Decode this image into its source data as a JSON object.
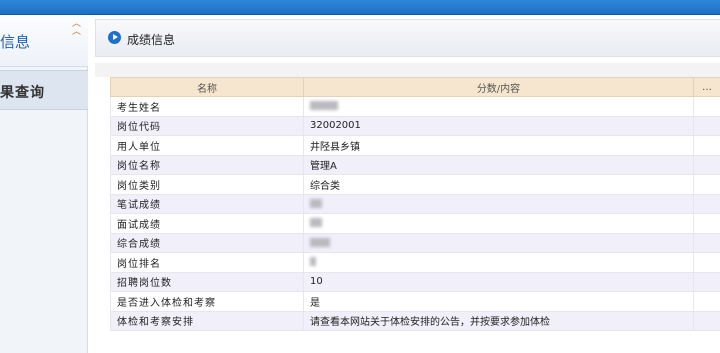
{
  "sidebar": {
    "title": "信息",
    "collapse_icon": "double-chevron-up",
    "item": "果查询"
  },
  "header": {
    "title": "成绩信息",
    "icon": "play-circle-icon"
  },
  "table": {
    "columns": [
      "名称",
      "分数/内容",
      "…"
    ],
    "rows": [
      {
        "name": "考生姓名",
        "value": ""
      },
      {
        "name": "岗位代码",
        "value": "32002001"
      },
      {
        "name": "用人单位",
        "value": "井陉县乡镇"
      },
      {
        "name": "岗位名称",
        "value": "管理A"
      },
      {
        "name": "岗位类别",
        "value": "综合类"
      },
      {
        "name": "笔试成绩",
        "value": ""
      },
      {
        "name": "面试成绩",
        "value": ""
      },
      {
        "name": "综合成绩",
        "value": ""
      },
      {
        "name": "岗位排名",
        "value": ""
      },
      {
        "name": "招聘岗位数",
        "value": "10"
      },
      {
        "name": "是否进入体检和考察",
        "value": "是"
      },
      {
        "name": "体检和考察安排",
        "value": "请查看本网站关于体检安排的公告，并按要求参加体检"
      }
    ]
  },
  "colors": {
    "topbar": "#1d6fc6",
    "header_row": "#f7e6cf",
    "stripe": "#f1effa"
  }
}
